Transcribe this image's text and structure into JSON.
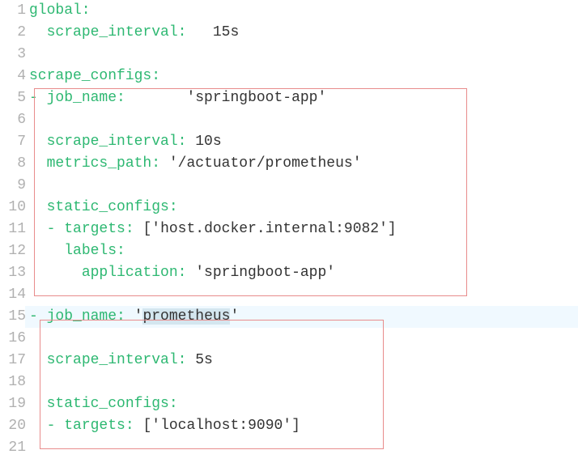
{
  "lines": {
    "l1": {
      "key": "global:",
      "num": "1"
    },
    "l2": {
      "indent": "  ",
      "key": "scrape_interval:",
      "gap": "   ",
      "val": "15s",
      "num": "2"
    },
    "l3": {
      "num": "3"
    },
    "l4": {
      "key": "scrape_configs:",
      "num": "4"
    },
    "l5": {
      "dash": "- ",
      "key": "job_name:",
      "gap": "       ",
      "str": "'springboot-app'",
      "num": "5"
    },
    "l6": {
      "num": "6"
    },
    "l7": {
      "indent": "  ",
      "key": "scrape_interval:",
      "gap": " ",
      "val": "10s",
      "num": "7"
    },
    "l8": {
      "indent": "  ",
      "key": "metrics_path:",
      "gap": " ",
      "str": "'/actuator/prometheus'",
      "num": "8"
    },
    "l9": {
      "num": "9"
    },
    "l10": {
      "indent": "  ",
      "key": "static_configs:",
      "num": "10"
    },
    "l11": {
      "indent": "  ",
      "dash": "- ",
      "key": "targets:",
      "gap": " ",
      "bopen": "[",
      "str": "'host.docker.internal:9082'",
      "bclose": "]",
      "num": "11"
    },
    "l12": {
      "indent": "    ",
      "key": "labels:",
      "num": "12"
    },
    "l13": {
      "indent": "      ",
      "key": "application:",
      "gap": " ",
      "str": "'springboot-app'",
      "num": "13"
    },
    "l14": {
      "num": "14"
    },
    "l15": {
      "dash": "- ",
      "key": "job_name:",
      "gap": " ",
      "qopen": "'",
      "sel": "prometheus",
      "qclose": "'",
      "num": "15"
    },
    "l16": {
      "num": "16"
    },
    "l17": {
      "indent": "  ",
      "key": "scrape_interval:",
      "gap": " ",
      "val": "5s",
      "num": "17"
    },
    "l18": {
      "num": "18"
    },
    "l19": {
      "indent": "  ",
      "key": "static_configs:",
      "num": "19"
    },
    "l20": {
      "indent": "  ",
      "dash": "- ",
      "key": "targets:",
      "gap": " ",
      "bopen": "[",
      "str": "'localhost:9090'",
      "bclose": "]",
      "num": "20"
    },
    "l21": {
      "num": "21"
    }
  }
}
